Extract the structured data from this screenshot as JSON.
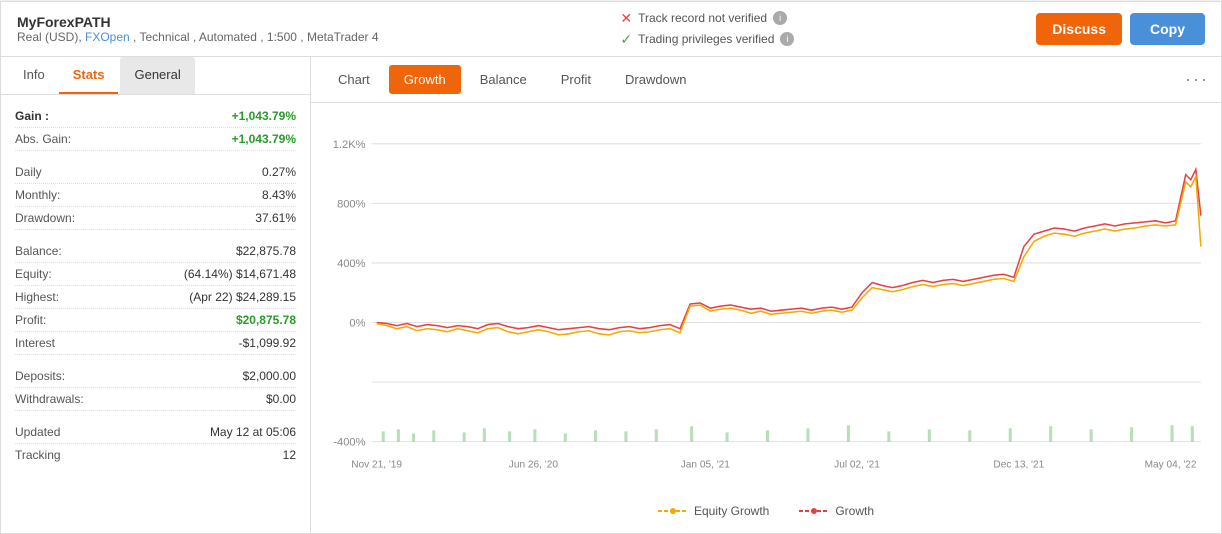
{
  "header": {
    "title": "MyForexPATH",
    "subtitle": "Real (USD), FXOpen , Technical , Automated , 1:500 , MetaTrader 4",
    "fx_open_label": "FXOpen",
    "track_record": "Track record not verified",
    "trading_privileges": "Trading privileges verified",
    "btn_discuss": "Discuss",
    "btn_copy": "Copy"
  },
  "left_tabs": [
    {
      "label": "Info",
      "active": false
    },
    {
      "label": "Stats",
      "active": true
    },
    {
      "label": "General",
      "active": false
    }
  ],
  "stats": {
    "gain_label": "Gain :",
    "gain_value": "+1,043.79%",
    "abs_gain_label": "Abs. Gain:",
    "abs_gain_value": "+1,043.79%",
    "daily_label": "Daily",
    "daily_value": "0.27%",
    "monthly_label": "Monthly:",
    "monthly_value": "8.43%",
    "drawdown_label": "Drawdown:",
    "drawdown_value": "37.61%",
    "balance_label": "Balance:",
    "balance_value": "$22,875.78",
    "equity_label": "Equity:",
    "equity_note": "(64.14%)",
    "equity_value": "$14,671.48",
    "highest_label": "Highest:",
    "highest_note": "(Apr 22)",
    "highest_value": "$24,289.15",
    "profit_label": "Profit:",
    "profit_value": "$20,875.78",
    "interest_label": "Interest",
    "interest_value": "-$1,099.92",
    "deposits_label": "Deposits:",
    "deposits_value": "$2,000.00",
    "withdrawals_label": "Withdrawals:",
    "withdrawals_value": "$0.00",
    "updated_label": "Updated",
    "updated_value": "May 12 at 05:06",
    "tracking_label": "Tracking",
    "tracking_value": "12"
  },
  "chart_tabs": [
    {
      "label": "Chart",
      "active": false
    },
    {
      "label": "Growth",
      "active": true
    },
    {
      "label": "Balance",
      "active": false
    },
    {
      "label": "Profit",
      "active": false
    },
    {
      "label": "Drawdown",
      "active": false
    }
  ],
  "chart": {
    "y_labels": [
      "1.2K%",
      "800%",
      "400%",
      "0%",
      "-400%"
    ],
    "x_labels": [
      "Nov 21, '19",
      "Jun 26, '20",
      "Jan 05, '21",
      "Jul 02, '21",
      "Dec 13, '21",
      "May 04, '22"
    ],
    "legend": [
      {
        "label": "Equity Growth",
        "color": "#f5a800"
      },
      {
        "label": "Growth",
        "color": "#e84040"
      }
    ]
  },
  "more_options": "···"
}
